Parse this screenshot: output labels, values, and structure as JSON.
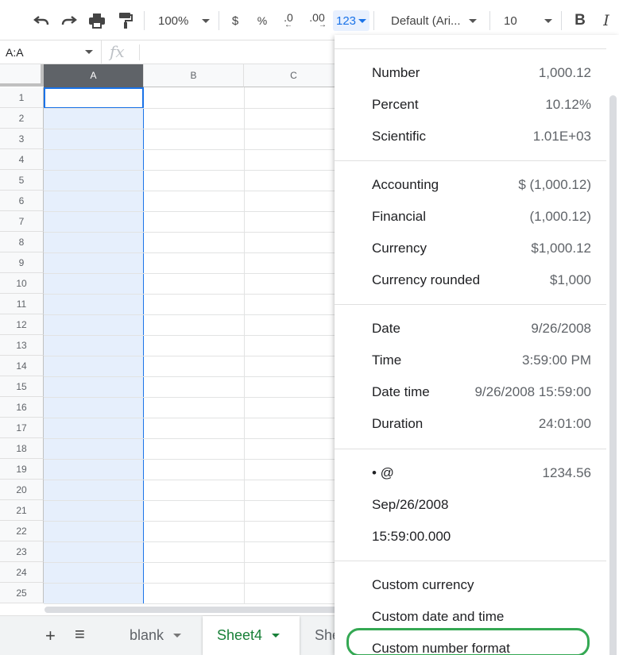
{
  "toolbar": {
    "zoom": "100%",
    "currency_symbol": "$",
    "percent_symbol": "%",
    "decrease_decimal": ".0",
    "increase_decimal": ".00",
    "more_formats": "123",
    "font": "Default (Ari...",
    "font_size": "10",
    "bold": "B",
    "italic": "I"
  },
  "formula_bar": {
    "name_box": "A:A",
    "fx": "fx"
  },
  "grid": {
    "columns": [
      "A",
      "B",
      "C"
    ],
    "rows": [
      "1",
      "2",
      "3",
      "4",
      "5",
      "6",
      "7",
      "8",
      "9",
      "10",
      "11",
      "12",
      "13",
      "14",
      "15",
      "16",
      "17",
      "18",
      "19",
      "20",
      "21",
      "22",
      "23",
      "24",
      "25"
    ]
  },
  "sheets": {
    "tabs": [
      {
        "label": "blank"
      },
      {
        "label": "Sheet4"
      },
      {
        "label": "She"
      }
    ]
  },
  "menu": {
    "items": [
      {
        "label": "Number",
        "example": "1,000.12"
      },
      {
        "label": "Percent",
        "example": "10.12%"
      },
      {
        "label": "Scientific",
        "example": "1.01E+03"
      },
      {
        "label": "Accounting",
        "example": "$ (1,000.12)"
      },
      {
        "label": "Financial",
        "example": "(1,000.12)"
      },
      {
        "label": "Currency",
        "example": "$1,000.12"
      },
      {
        "label": "Currency rounded",
        "example": "$1,000"
      },
      {
        "label": "Date",
        "example": "9/26/2008"
      },
      {
        "label": "Time",
        "example": "3:59:00 PM"
      },
      {
        "label": "Date time",
        "example": "9/26/2008 15:59:00"
      },
      {
        "label": "Duration",
        "example": "24:01:00"
      },
      {
        "label": "• @",
        "example": "1234.56"
      },
      {
        "label": "Sep/26/2008",
        "example": ""
      },
      {
        "label": "15:59:00.000",
        "example": ""
      },
      {
        "label": "Custom currency",
        "example": ""
      },
      {
        "label": "Custom date and time",
        "example": ""
      },
      {
        "label": "Custom number format",
        "example": ""
      }
    ]
  },
  "colors": {
    "accent": "#1a73e8",
    "active_sheet": "#188038",
    "highlight_ring": "#34a853"
  }
}
